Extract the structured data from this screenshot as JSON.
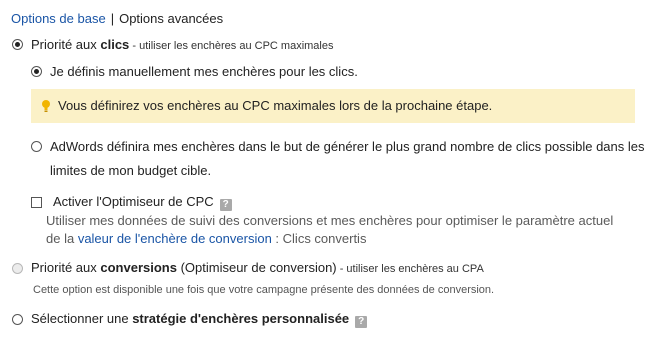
{
  "tabs": {
    "basic": "Options de base",
    "separator": "|",
    "advanced": "Options avancées"
  },
  "clicks_priority": {
    "label_prefix": "Priorité aux ",
    "label_bold": "clics",
    "label_suffix": " - utiliser les enchères au CPC maximales",
    "checked": true
  },
  "manual_bids": {
    "label": "Je définis manuellement mes enchères pour les clics.",
    "checked": true
  },
  "notice": {
    "text": "Vous définirez vos enchères au CPC maximales lors de la prochaine étape.",
    "icon": "lightbulb-icon",
    "background": "#fbf1c7"
  },
  "auto_bids": {
    "line1": "AdWords définira mes enchères dans le but de générer le plus grand nombre de clics possible dans les",
    "line2": "limites de mon budget cible.",
    "checked": false
  },
  "cpc_optimizer": {
    "label": "Activer l'Optimiseur de CPC",
    "help": "?",
    "checked": false,
    "desc_line1": "Utiliser mes données de suivi des conversions et mes enchères pour optimiser le paramètre actuel",
    "desc_line2_prefix": "de la ",
    "desc_line2_link": "valeur de l'enchère de conversion",
    "desc_line2_suffix": " : Clics convertis"
  },
  "conversions_priority": {
    "label_prefix": "Priorité aux ",
    "label_bold": "conversions",
    "label_mid": " (Optimiseur de conversion)",
    "label_suffix": " - utiliser les enchères au CPA",
    "note": "Cette option est disponible une fois que votre campagne présente des données de conversion.",
    "disabled": true
  },
  "custom_strategy": {
    "label_prefix": "Sélectionner une ",
    "label_bold": "stratégie d'enchères personnalisée",
    "help": "?",
    "checked": false
  },
  "colors": {
    "link": "#1a55a6",
    "text": "#222222"
  }
}
